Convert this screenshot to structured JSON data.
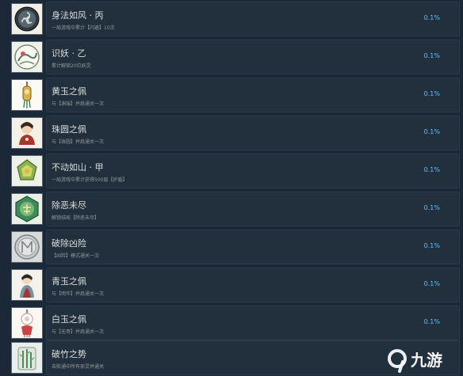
{
  "achievements": [
    {
      "icon": "spiral-coin-icon",
      "title": "身法如风 · 丙",
      "desc": "一局游戏中累计【闪避】10次",
      "pct": "0.1%"
    },
    {
      "icon": "painted-scroll-icon",
      "title": "识妖 · 乙",
      "desc": "累计解锁20位妖灵",
      "pct": "0.1%"
    },
    {
      "icon": "yellow-jade-pendant-icon",
      "title": "黄玉之佩",
      "desc": "与【渊瑞】并肩通关一次",
      "pct": "0.1%"
    },
    {
      "icon": "pearl-pendant-icon",
      "title": "珠圆之佩",
      "desc": "与【珠圆】并肩通关一次",
      "pct": "0.1%"
    },
    {
      "icon": "green-emblem-icon",
      "title": "不动如山 · 甲",
      "desc": "一局游戏中累计获得500层【护盾】",
      "pct": "0.1%"
    },
    {
      "icon": "green-jade-medallion-icon",
      "title": "除恶未尽",
      "desc": "解锁结局【除恶未尽】",
      "pct": "0.1%"
    },
    {
      "icon": "silver-coin-icon",
      "title": "破除凶险",
      "desc": "【凶险】模式通关一次",
      "pct": "0.1%"
    },
    {
      "icon": "azure-jade-pendant-icon",
      "title": "青玉之佩",
      "desc": "与【明华】并肩通关一次",
      "pct": "0.1%"
    },
    {
      "icon": "white-jade-pendant-icon",
      "title": "白玉之佩",
      "desc": "与【无哥】并肩通关一次",
      "pct": "0.1%"
    },
    {
      "icon": "bamboo-scene-icon",
      "title": "破竹之势",
      "desc": "击败通中所有邪灵并通关",
      "pct": ""
    }
  ],
  "watermark": {
    "text": "九游",
    "logo": "9game-logo-icon"
  },
  "colors": {
    "background": "#1b2838",
    "row": "#22303d",
    "title": "#dcdedf",
    "desc": "#8f98a0",
    "percent": "#66c0f4",
    "watermark": "#ffffff"
  }
}
